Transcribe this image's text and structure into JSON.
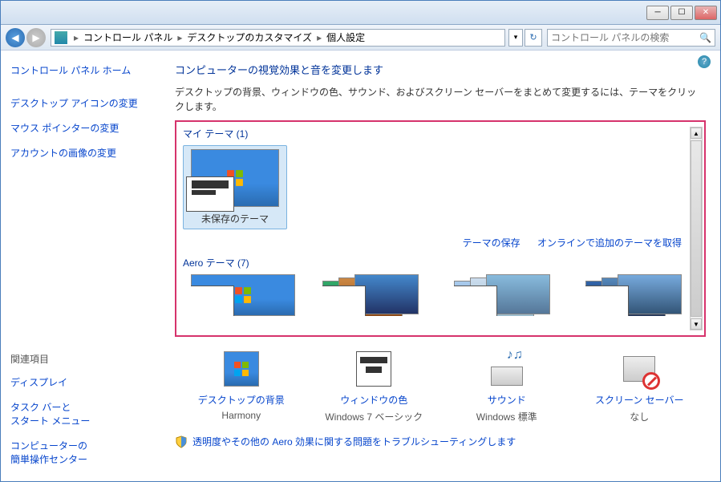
{
  "breadcrumb": {
    "seg1": "コントロール パネル",
    "seg2": "デスクトップのカスタマイズ",
    "seg3": "個人設定"
  },
  "search": {
    "placeholder": "コントロール パネルの検索"
  },
  "sidebar": {
    "home": "コントロール パネル ホーム",
    "link1": "デスクトップ アイコンの変更",
    "link2": "マウス ポインターの変更",
    "link3": "アカウントの画像の変更",
    "related_hdr": "関連項目",
    "rel1": "ディスプレイ",
    "rel2": "タスク バーと",
    "rel2b": "スタート メニュー",
    "rel3": "コンピューターの",
    "rel3b": "簡単操作センター"
  },
  "content": {
    "heading": "コンピューターの視覚効果と音を変更します",
    "desc": "デスクトップの背景、ウィンドウの色、サウンド、およびスクリーン セーバーをまとめて変更するには、テーマをクリックします。",
    "sect_my": "マイ テーマ (1)",
    "theme_unsaved": "未保存のテーマ",
    "save_theme": "テーマの保存",
    "get_online": "オンラインで追加のテーマを取得",
    "sect_aero": "Aero テーマ (7)"
  },
  "bottom": {
    "b1_label": "デスクトップの背景",
    "b1_value": "Harmony",
    "b2_label": "ウィンドウの色",
    "b2_value": "Windows 7 ベーシック",
    "b3_label": "サウンド",
    "b3_value": "Windows 標準",
    "b4_label": "スクリーン セーバー",
    "b4_value": "なし"
  },
  "troubleshoot": "透明度やその他の Aero 効果に関する問題をトラブルシューティングします"
}
